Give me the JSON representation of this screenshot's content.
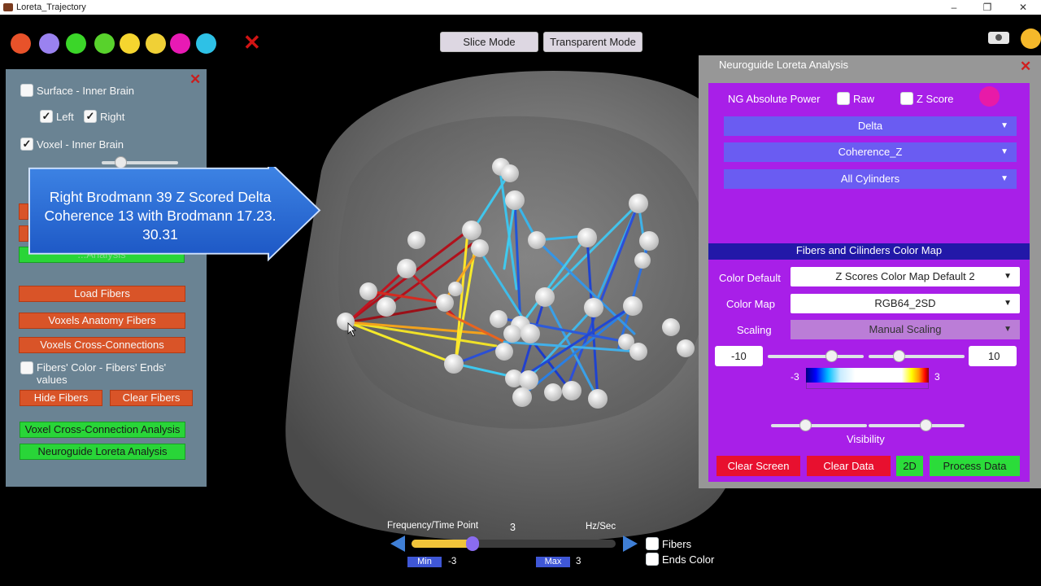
{
  "window": {
    "title": "Loreta_Trajectory"
  },
  "toolbar": {
    "color_swatches": [
      "#e8522a",
      "#9a82f0",
      "#3bd629",
      "#58d22c",
      "#f5d52f",
      "#f0d036",
      "#e81ab4",
      "#2ec1e6"
    ],
    "slice_mode_label": "Slice Mode",
    "transparent_mode_label": "Transparent Mode"
  },
  "left_panel": {
    "surface_label": "Surface - Inner Brain",
    "left_label": "Left",
    "right_label": "Right",
    "voxel_label": "Voxel - Inner Brain",
    "load_fibers_label": "Load Fibers",
    "voxels_anatomy_fibers_label": "Voxels Anatomy Fibers",
    "voxels_cross_connections_label": "Voxels Cross-Connections",
    "fibers_color_label": "Fibers' Color - Fibers' Ends' values",
    "hide_fibers_label": "Hide Fibers",
    "clear_fibers_label": "Clear Fibers",
    "voxel_cross_connection_analysis_label": "Voxel Cross-Connection Analysis",
    "neuroguide_loreta_analysis_label": "Neuroguide Loreta Analysis",
    "hidden_button_label": "...Analysis"
  },
  "callout": {
    "text": "Right Brodmann 39 Z Scored Delta Coherence 13 with Brodmann 17.23. 30.31"
  },
  "right_panel": {
    "title": "Neuroguide Loreta Analysis",
    "ng_absolute_power_label": "NG Absolute Power",
    "raw_label": "Raw",
    "zscore_label": "Z Score",
    "band_select": "Delta",
    "measure_select": "Coherence_Z",
    "cylinders_select": "All Cylinders",
    "color_map_section_title": "Fibers and Cilinders Color Map",
    "color_default_label": "Color Default",
    "color_default_value": "Z Scores Color Map Default 2",
    "color_map_label": "Color Map",
    "color_map_value": "RGB64_2SD",
    "scaling_label": "Scaling",
    "scaling_value": "Manual Scaling",
    "min_value": "-10",
    "max_value": "10",
    "colorbar_min": "-3",
    "colorbar_max": "3",
    "visibility_label": "Visibility",
    "clear_screen_label": "Clear Screen",
    "clear_data_label": "Clear Data",
    "two_d_label": "2D",
    "process_data_label": "Process Data"
  },
  "bottom_controls": {
    "frequency_label": "Frequency/Time Point",
    "frequency_value": "3",
    "unit_label": "Hz/Sec",
    "min_label": "Min",
    "min_value": "-3",
    "max_label": "Max",
    "max_value": "3",
    "fibers_label": "Fibers",
    "ends_color_label": "Ends Color"
  }
}
